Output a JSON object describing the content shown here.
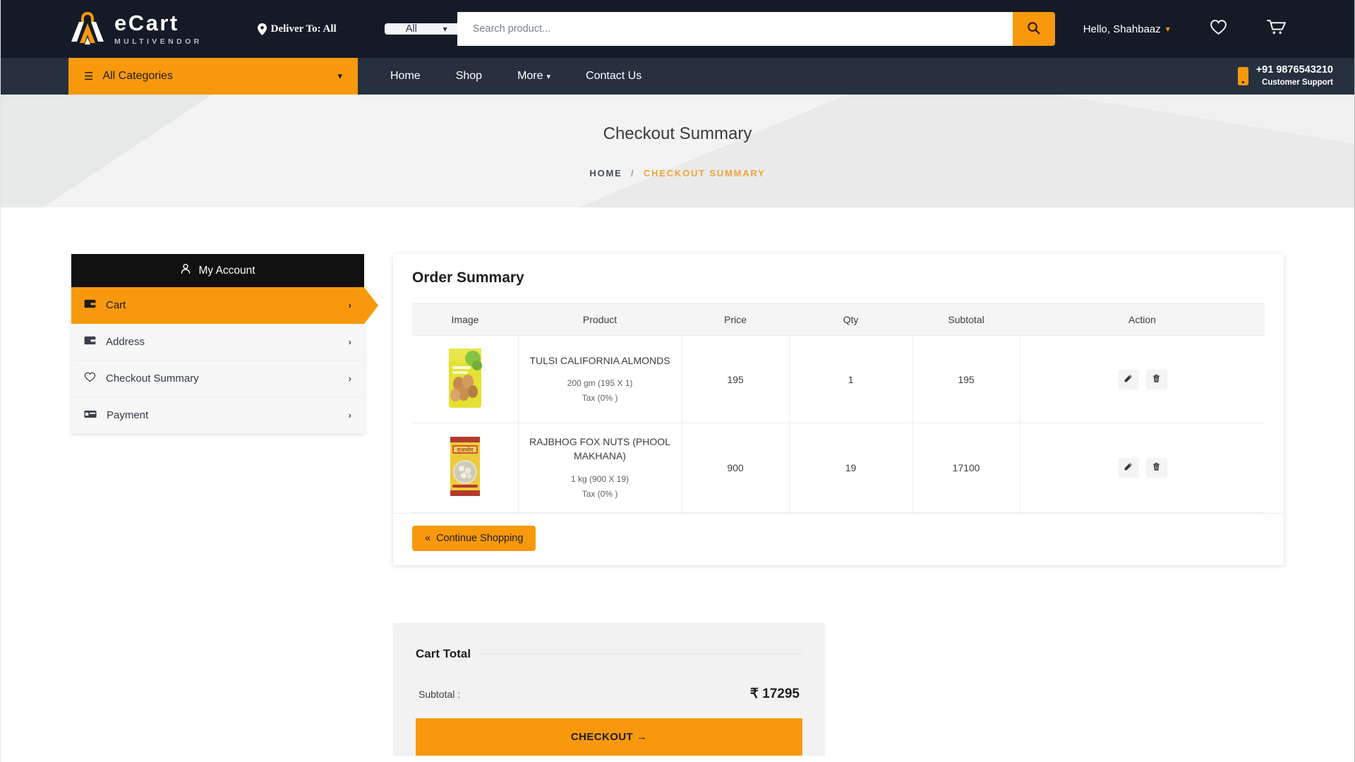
{
  "header": {
    "logo_name": "eCart",
    "logo_sub": "MULTIVENDOR",
    "deliver_to": "Deliver To: All",
    "search": {
      "category_selected": "All",
      "placeholder": "Search product...",
      "value": ""
    },
    "account_greeting": "Hello, Shahbaaz",
    "wishlist_icon": "heart-icon",
    "cart_icon": "cart-icon"
  },
  "nav": {
    "all_categories": "All Categories",
    "links": [
      {
        "label": "Home",
        "has_caret": false
      },
      {
        "label": "Shop",
        "has_caret": false
      },
      {
        "label": "More",
        "has_caret": true
      },
      {
        "label": "Contact Us",
        "has_caret": false
      }
    ],
    "support_number": "+91 9876543210",
    "support_label": "Customer Support"
  },
  "banner": {
    "title": "Checkout Summary",
    "breadcrumb_home": "HOME",
    "breadcrumb_sep": "/",
    "breadcrumb_current": "CHECKOUT SUMMARY"
  },
  "sidebar": {
    "account_header": "My Account",
    "items": [
      {
        "label": "Cart",
        "icon": "wallet-icon",
        "active": true
      },
      {
        "label": "Address",
        "icon": "wallet-icon",
        "active": false
      },
      {
        "label": "Checkout Summary",
        "icon": "heart-icon",
        "active": false
      },
      {
        "label": "Payment",
        "icon": "card-icon",
        "active": false
      }
    ]
  },
  "order_summary": {
    "title": "Order Summary",
    "columns": [
      "Image",
      "Product",
      "Price",
      "Qty",
      "Subtotal",
      "Action"
    ],
    "rows": [
      {
        "name": "TULSI CALIFORNIA ALMONDS",
        "variant": "200 gm (195 X 1)",
        "tax": "Tax (0% )",
        "price": "195",
        "qty": "1",
        "subtotal": "195"
      },
      {
        "name": "RAJBHOG FOX NUTS (PHOOL MAKHANA)",
        "variant": "1 kg (900 X 19)",
        "tax": "Tax (0% )",
        "price": "900",
        "qty": "19",
        "subtotal": "17100"
      }
    ],
    "continue_shopping": "Continue Shopping",
    "edit_icon": "pencil-icon",
    "delete_icon": "trash-icon"
  },
  "cart_total": {
    "title": "Cart Total",
    "subtotal_label": "Subtotal :",
    "subtotal_value": "₹ 17295",
    "checkout_label": "CHECKOUT"
  },
  "colors": {
    "accent": "#f8990d",
    "header_bg": "#141b26",
    "nav_bg": "#26303f",
    "dark": "#111111"
  }
}
